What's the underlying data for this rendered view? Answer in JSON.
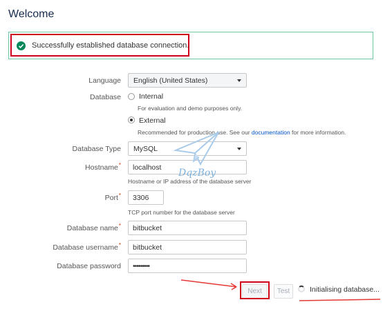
{
  "page": {
    "title": "Welcome"
  },
  "alert": {
    "text": "Successfully established database connection.",
    "icon": "check-circle-icon"
  },
  "form": {
    "language": {
      "label": "Language",
      "value": "English (United States)"
    },
    "database": {
      "label": "Database",
      "internal": {
        "label": "Internal",
        "hint": "For evaluation and demo purposes only.",
        "checked": false
      },
      "external": {
        "label": "External",
        "hint_before": "Recommended for production use. See our ",
        "hint_link": "documentation",
        "hint_after": " for more information.",
        "checked": true
      }
    },
    "database_type": {
      "label": "Database Type",
      "value": "MySQL"
    },
    "hostname": {
      "label": "Hostname",
      "value": "localhost",
      "hint": "Hostname or IP address of the database server"
    },
    "port": {
      "label": "Port",
      "value": "3306",
      "hint": "TCP port number for the database server"
    },
    "database_name": {
      "label": "Database name",
      "value": "bitbucket"
    },
    "database_username": {
      "label": "Database username",
      "value": "bitbucket"
    },
    "database_password": {
      "label": "Database password",
      "value": "•••••••••"
    },
    "required_marker": "*"
  },
  "buttons": {
    "next": "Next",
    "test": "Test"
  },
  "status": {
    "text": "Initialising database..."
  },
  "watermark": {
    "text": "DqzBoy"
  },
  "colors": {
    "success": "#00875a",
    "highlight": "#d0021b",
    "link": "#0052cc"
  }
}
